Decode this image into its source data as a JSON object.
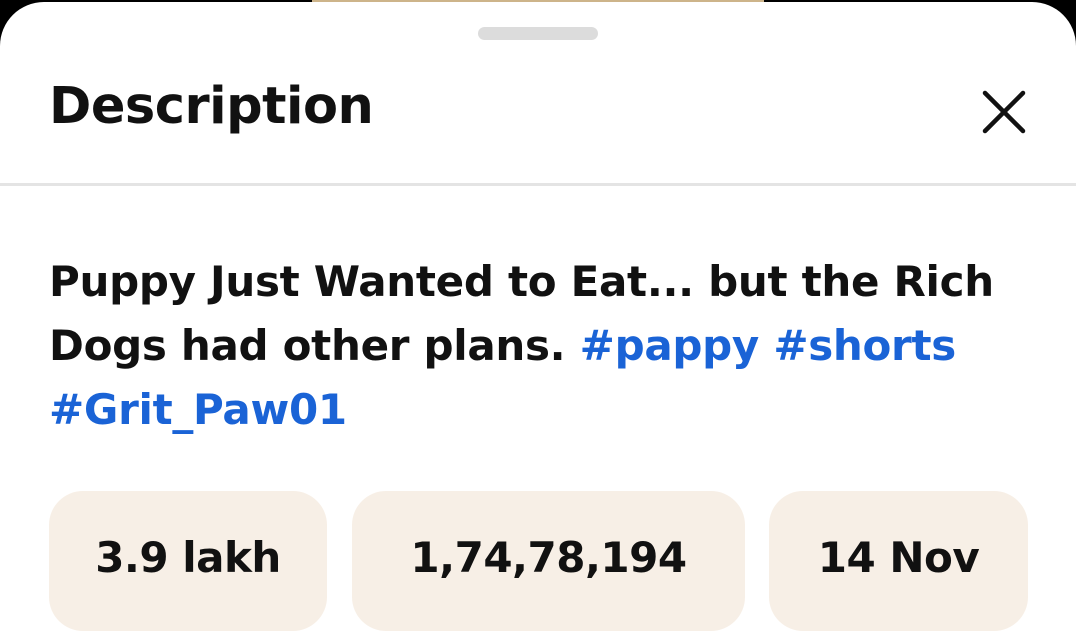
{
  "sheet": {
    "title": "Description",
    "close_icon": "close-icon"
  },
  "description": {
    "text": "Puppy Just Wanted to Eat... but the Rich Dogs had other plans. ",
    "hashtags": [
      "#pappy",
      "#shorts",
      "#Grit_Paw01"
    ]
  },
  "stats": [
    {
      "value": "3.9 lakh"
    },
    {
      "value": "1,74,78,194"
    },
    {
      "value": "14 Nov"
    }
  ],
  "colors": {
    "hashtag": "#1a63d6",
    "card_background": "#f7efe6",
    "sheet_background": "#ffffff"
  }
}
